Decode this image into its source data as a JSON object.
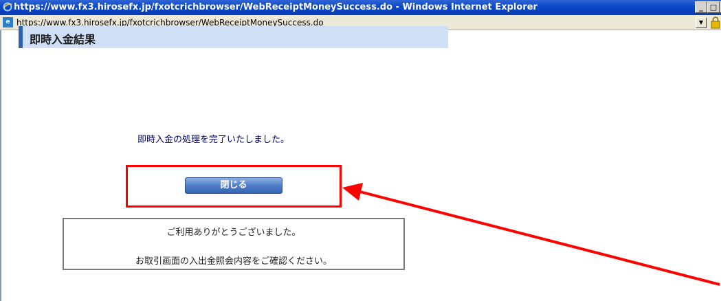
{
  "window": {
    "title": "https://www.fx3.hirosefx.jp/fxotcrichbrowser/WebReceiptMoneySuccess.do - Windows Internet Explorer",
    "minimize": "_",
    "maximize": "□",
    "close": "×"
  },
  "address_bar": {
    "url": "https://www.fx3.hirosefx.jp/fxotcrichbrowser/WebReceiptMoneySuccess.do",
    "dropdown_symbol": "▼"
  },
  "page": {
    "section_title": "即時入金結果",
    "message": "即時入金の処理を完了いたしました。",
    "close_button_label": "閉じる",
    "info_line1": "ご利用ありがとうございました。",
    "info_line2": "お取引画面の入出金照会内容をご確認ください。"
  },
  "colors": {
    "titlebar": "#0a47c9",
    "section_header_bg": "#cfe0f6",
    "section_header_accent": "#2e62b0",
    "annotation_red": "#ff0000",
    "button_blue": "#4f7ec8"
  },
  "icons": [
    "ie-logo-icon",
    "page-icon",
    "dropdown-arrow-icon",
    "lock-icon",
    "annotation-arrow-icon"
  ]
}
